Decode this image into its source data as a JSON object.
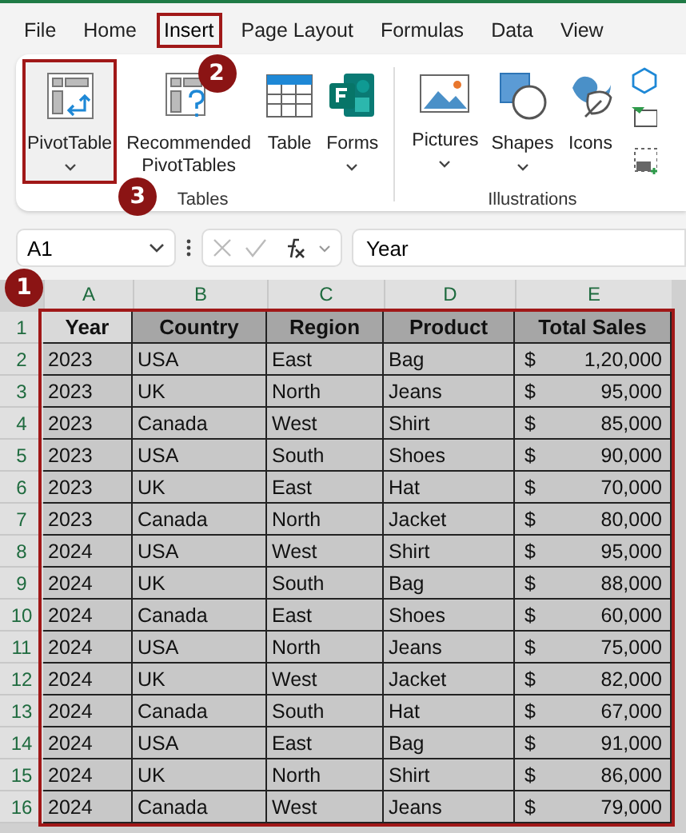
{
  "tabs": [
    {
      "label": "File",
      "selected": false,
      "highlighted": false
    },
    {
      "label": "Home",
      "selected": false,
      "highlighted": false
    },
    {
      "label": "Insert",
      "selected": true,
      "highlighted": true,
      "callout": "2"
    },
    {
      "label": "Page Layout",
      "selected": false,
      "highlighted": false
    },
    {
      "label": "Formulas",
      "selected": false,
      "highlighted": false
    },
    {
      "label": "Data",
      "selected": false,
      "highlighted": false
    },
    {
      "label": "View",
      "selected": false,
      "highlighted": false
    }
  ],
  "ribbon": {
    "groups": [
      {
        "label": "Tables",
        "commands": [
          {
            "kind": "pivot",
            "label": "PivotTable",
            "dropdown": true,
            "highlighted": true,
            "callout": "3"
          },
          {
            "kind": "recommended",
            "label": "Recommended PivotTables",
            "dropdown": false,
            "highlighted": false
          },
          {
            "kind": "table",
            "label": "Table",
            "dropdown": false,
            "highlighted": false
          },
          {
            "kind": "forms",
            "label": "Forms",
            "dropdown": true,
            "highlighted": false
          }
        ]
      },
      {
        "label": "Illustrations",
        "commands": [
          {
            "kind": "pictures",
            "label": "Pictures",
            "dropdown": true,
            "highlighted": false
          },
          {
            "kind": "shapes",
            "label": "Shapes",
            "dropdown": true,
            "highlighted": false
          },
          {
            "kind": "icons",
            "label": "Icons",
            "dropdown": false,
            "highlighted": false
          },
          {
            "kind": "more"
          }
        ]
      }
    ]
  },
  "formula_bar": {
    "name_box": "A1",
    "formula": "Year"
  },
  "sheet": {
    "columns": [
      "A",
      "B",
      "C",
      "D",
      "E"
    ],
    "highlighted": true,
    "callout": "1",
    "header": {
      "number": "1",
      "cells": [
        {
          "text": "Year",
          "selected": true
        },
        {
          "text": "Country",
          "selected": false
        },
        {
          "text": "Region",
          "selected": false
        },
        {
          "text": "Product",
          "selected": false
        },
        {
          "text": "Total Sales",
          "selected": false
        }
      ]
    },
    "rows": [
      {
        "number": "2",
        "cells": [
          "2023",
          "USA",
          "East",
          "Bag"
        ],
        "sales": {
          "symbol": "$",
          "amount": "1,20,000"
        }
      },
      {
        "number": "3",
        "cells": [
          "2023",
          "UK",
          "North",
          "Jeans"
        ],
        "sales": {
          "symbol": "$",
          "amount": "95,000"
        }
      },
      {
        "number": "4",
        "cells": [
          "2023",
          "Canada",
          "West",
          "Shirt"
        ],
        "sales": {
          "symbol": "$",
          "amount": "85,000"
        }
      },
      {
        "number": "5",
        "cells": [
          "2023",
          "USA",
          "South",
          "Shoes"
        ],
        "sales": {
          "symbol": "$",
          "amount": "90,000"
        }
      },
      {
        "number": "6",
        "cells": [
          "2023",
          "UK",
          "East",
          "Hat"
        ],
        "sales": {
          "symbol": "$",
          "amount": "70,000"
        }
      },
      {
        "number": "7",
        "cells": [
          "2023",
          "Canada",
          "North",
          "Jacket"
        ],
        "sales": {
          "symbol": "$",
          "amount": "80,000"
        }
      },
      {
        "number": "8",
        "cells": [
          "2024",
          "USA",
          "West",
          "Shirt"
        ],
        "sales": {
          "symbol": "$",
          "amount": "95,000"
        }
      },
      {
        "number": "9",
        "cells": [
          "2024",
          "UK",
          "South",
          "Bag"
        ],
        "sales": {
          "symbol": "$",
          "amount": "88,000"
        }
      },
      {
        "number": "10",
        "cells": [
          "2024",
          "Canada",
          "East",
          "Shoes"
        ],
        "sales": {
          "symbol": "$",
          "amount": "60,000"
        }
      },
      {
        "number": "11",
        "cells": [
          "2024",
          "USA",
          "North",
          "Jeans"
        ],
        "sales": {
          "symbol": "$",
          "amount": "75,000"
        }
      },
      {
        "number": "12",
        "cells": [
          "2024",
          "UK",
          "West",
          "Jacket"
        ],
        "sales": {
          "symbol": "$",
          "amount": "82,000"
        }
      },
      {
        "number": "13",
        "cells": [
          "2024",
          "Canada",
          "South",
          "Hat"
        ],
        "sales": {
          "symbol": "$",
          "amount": "67,000"
        }
      },
      {
        "number": "14",
        "cells": [
          "2024",
          "USA",
          "East",
          "Bag"
        ],
        "sales": {
          "symbol": "$",
          "amount": "91,000"
        }
      },
      {
        "number": "15",
        "cells": [
          "2024",
          "UK",
          "North",
          "Shirt"
        ],
        "sales": {
          "symbol": "$",
          "amount": "86,000"
        }
      },
      {
        "number": "16",
        "cells": [
          "2024",
          "Canada",
          "West",
          "Jeans"
        ],
        "sales": {
          "symbol": "$",
          "amount": "79,000"
        }
      }
    ]
  }
}
